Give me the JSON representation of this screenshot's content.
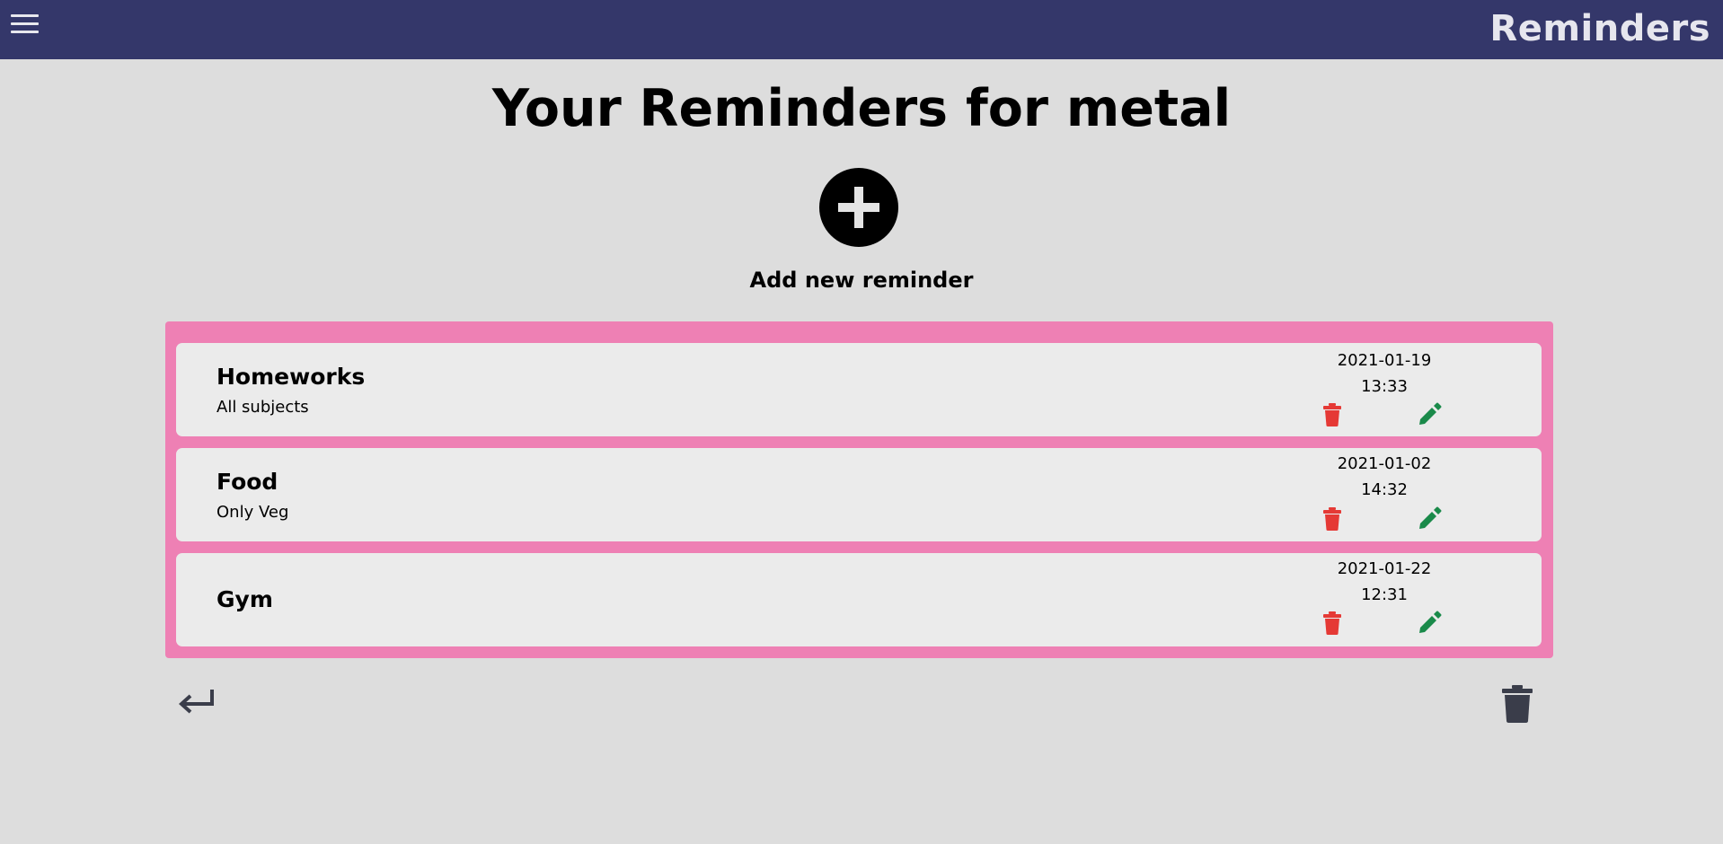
{
  "header": {
    "app_title": "Reminders",
    "menu_icon": "hamburger-menu-icon"
  },
  "main": {
    "title": "Your Reminders for metal",
    "add_button_icon": "plus-circle-icon",
    "add_label": "Add new reminder"
  },
  "reminders": [
    {
      "title": "Homeworks",
      "description": "All subjects",
      "date": "2021-01-19",
      "time": "13:33"
    },
    {
      "title": "Food",
      "description": "Only Veg",
      "date": "2021-01-02",
      "time": "14:32"
    },
    {
      "title": "Gym",
      "description": "",
      "date": "2021-01-22",
      "time": "12:31"
    }
  ],
  "icons": {
    "delete": "trash-icon",
    "edit": "pencil-icon",
    "back": "return-arrow-icon",
    "clear_all": "trash-icon"
  },
  "colors": {
    "header_bg": "#34376a",
    "page_bg": "#dddddd",
    "panel_bg": "#ee80b4",
    "card_bg": "#ebebeb",
    "delete_red": "#e53935",
    "edit_green": "#1a8a4a",
    "footer_icon": "#3a3d4a"
  }
}
